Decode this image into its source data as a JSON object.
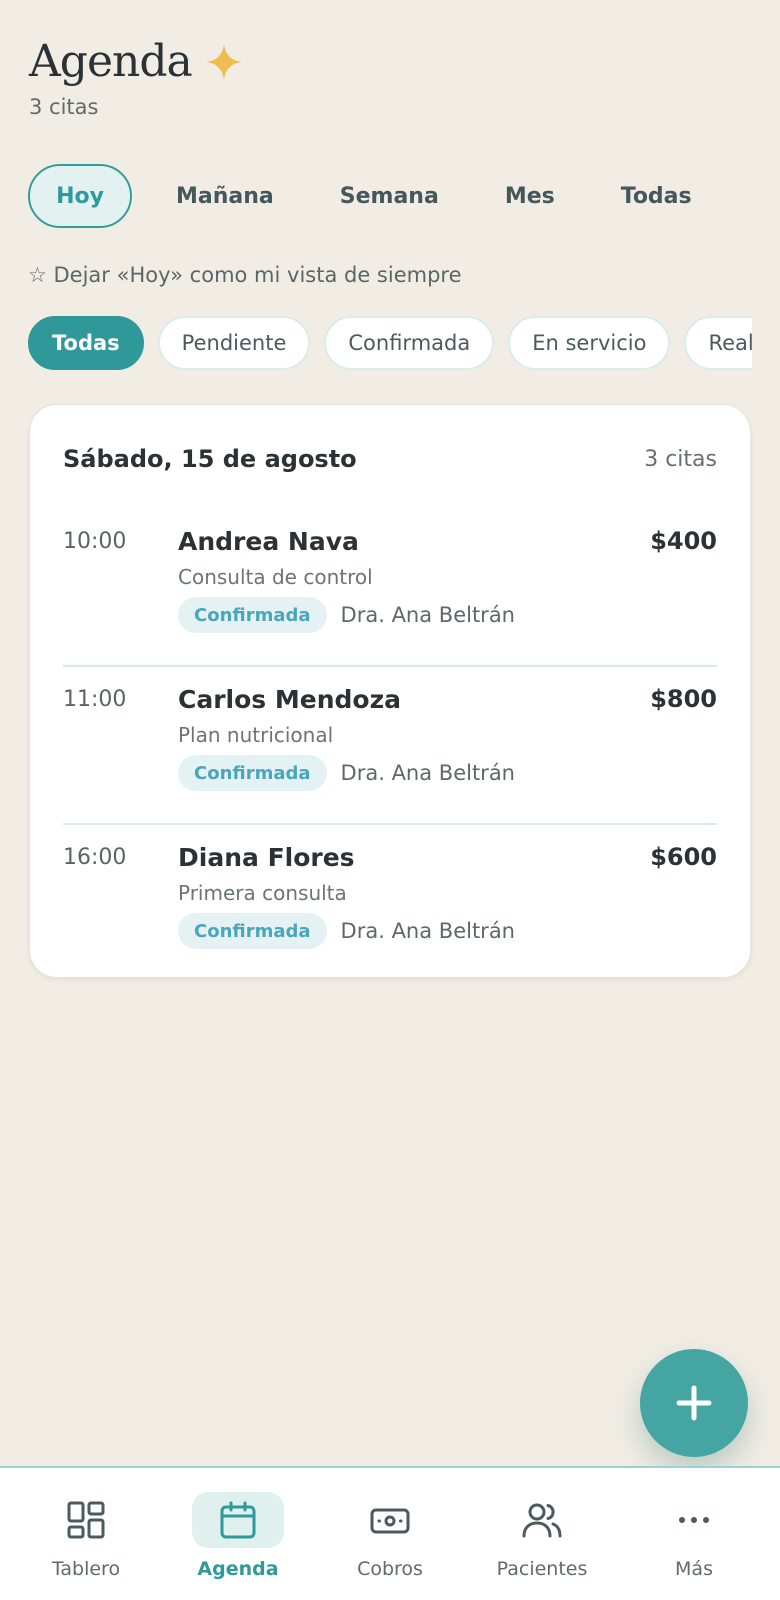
{
  "header": {
    "title": "Agenda",
    "subtitle": "3 citas",
    "icon": "sparkle-icon",
    "sparkle_color": "#efbd52"
  },
  "period_tabs": [
    {
      "label": "Hoy",
      "active": true
    },
    {
      "label": "Mañana"
    },
    {
      "label": "Semana"
    },
    {
      "label": "Mes"
    },
    {
      "label": "Todas"
    }
  ],
  "default_view_label": "☆ Dejar «Hoy» como mi vista de siempre",
  "status_filters": [
    {
      "label": "Todas",
      "active": true
    },
    {
      "label": "Pendiente"
    },
    {
      "label": "Confirmada"
    },
    {
      "label": "En servicio"
    },
    {
      "label": "Realizada"
    }
  ],
  "day_card": {
    "date": "Sábado, 15 de agosto",
    "count": "3 citas",
    "appointments": [
      {
        "time": "10:00",
        "patient": "Andrea Nava",
        "service": "Consulta de control",
        "status": "Confirmada",
        "doctor": "Dra. Ana Beltrán",
        "price": "$400"
      },
      {
        "time": "11:00",
        "patient": "Carlos Mendoza",
        "service": "Plan nutricional",
        "status": "Confirmada",
        "doctor": "Dra. Ana Beltrán",
        "price": "$800"
      },
      {
        "time": "16:00",
        "patient": "Diana Flores",
        "service": "Primera consulta",
        "status": "Confirmada",
        "doctor": "Dra. Ana Beltrán",
        "price": "$600"
      }
    ]
  },
  "fab": {
    "icon": "plus-icon"
  },
  "bottom_nav": [
    {
      "label": "Tablero",
      "icon": "grid-icon"
    },
    {
      "label": "Agenda",
      "icon": "calendar-icon",
      "active": true
    },
    {
      "label": "Cobros",
      "icon": "banknote-icon"
    },
    {
      "label": "Pacientes",
      "icon": "users-icon"
    },
    {
      "label": "Más",
      "icon": "more-icon"
    }
  ],
  "colors": {
    "accent": "#2f9999",
    "background": "#f1ede5",
    "badge_text": "#4aa6bd"
  }
}
